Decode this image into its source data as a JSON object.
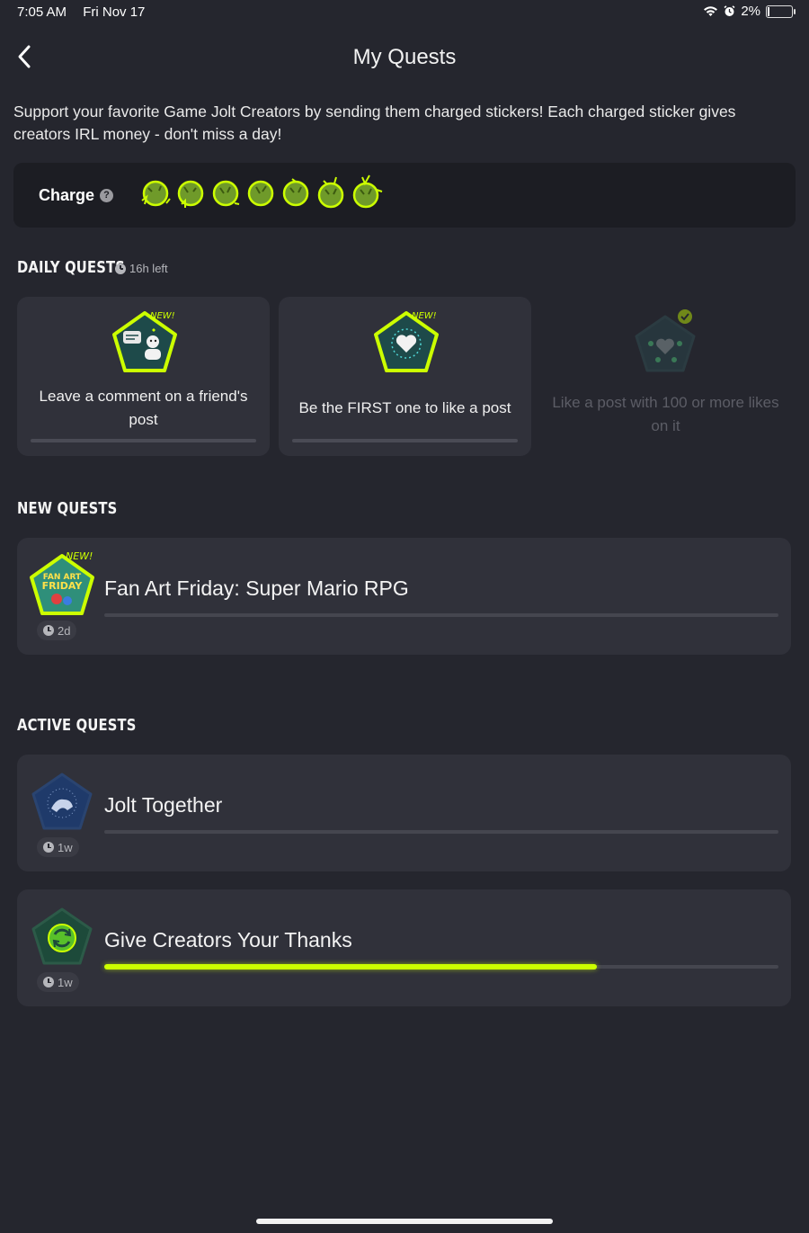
{
  "status": {
    "time": "7:05 AM",
    "date": "Fri Nov 17",
    "battery": "2%"
  },
  "header": {
    "title": "My Quests"
  },
  "description": "Support your favorite Game Jolt Creators by sending them charged stickers! Each charged sticker gives creators IRL money - don't miss a day!",
  "charge": {
    "label": "Charge",
    "help_glyph": "?",
    "orbs": 7
  },
  "daily": {
    "title": "DAILY QUESTS",
    "time_left": "16h left",
    "cards": [
      {
        "text": "Leave a comment on a friend's post",
        "badge_label": "NEW!",
        "icon": "comment-friend-icon",
        "progress": 0
      },
      {
        "text": "Be the FIRST one to like a post",
        "badge_label": "NEW!",
        "icon": "heart-icon",
        "progress": 0
      },
      {
        "text": "Like a post with 100 or more likes on it",
        "icon": "hearts-icon",
        "completed": true
      }
    ]
  },
  "new_quests": {
    "title": "NEW QUESTS",
    "items": [
      {
        "title": "Fan Art Friday: Super Mario RPG",
        "badge_label": "NEW!",
        "badge_text_1": "FAN ART",
        "badge_text_2": "FRIDAY",
        "time": "2d",
        "progress": 0
      }
    ]
  },
  "active_quests": {
    "title": "ACTIVE QUESTS",
    "items": [
      {
        "title": "Jolt Together",
        "time": "1w",
        "icon": "fist-bump-icon",
        "progress": 0
      },
      {
        "title": "Give Creators Your Thanks",
        "time": "1w",
        "icon": "recycle-thanks-icon",
        "progress": 0.73
      }
    ]
  },
  "colors": {
    "accent": "#ccff00",
    "background": "#25262e",
    "card": "#30313a"
  }
}
